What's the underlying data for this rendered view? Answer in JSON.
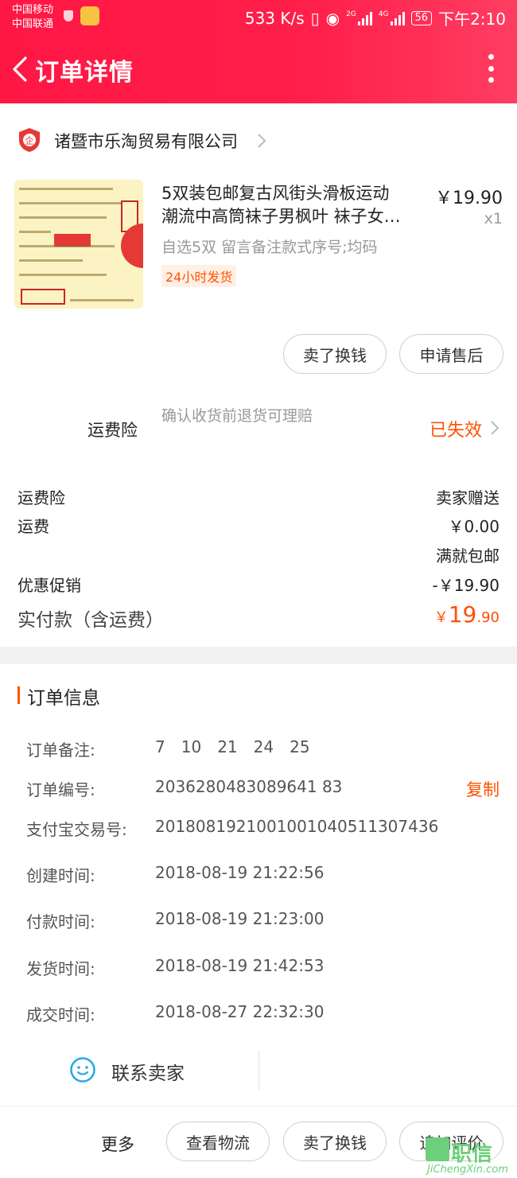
{
  "status_bar": {
    "carrier_1": "中国移动",
    "carrier_2": "中国联通",
    "speed": "533 K/s",
    "net_1": "2G",
    "net_2": "4G",
    "battery": "56",
    "time": "下午2:10"
  },
  "nav": {
    "title": "订单详情",
    "back_icon": "chevron-left-icon",
    "more_icon": "more-vertical-icon"
  },
  "shop": {
    "name": "诸暨市乐淘贸易有限公司",
    "icon": "enterprise-shield-icon",
    "icon_text": "企"
  },
  "product": {
    "title_line_1": "5双装包邮复古风街头滑板运动",
    "title_line_2": "潮流中高筒袜子男枫叶 袜子女…",
    "price": "￥19.90",
    "quantity": "x1",
    "sku": "自选5双 留言备注款式序号;均码",
    "badge": "24小时发货"
  },
  "item_actions": {
    "sell_exchange": "卖了换钱",
    "after_sale": "申请售后"
  },
  "insurance": {
    "label": "运费险",
    "description": "确认收货前退货可理赔",
    "status": "已失效"
  },
  "fees": [
    {
      "label": "运费险",
      "value": "卖家赠送"
    },
    {
      "label": "运费",
      "value": "￥0.00"
    },
    {
      "label": "",
      "value": "满就包邮"
    },
    {
      "label": "优惠促销",
      "value": "-￥19.90"
    }
  ],
  "total": {
    "label": "实付款（含运费）",
    "currency": "￥",
    "integer": "19",
    "decimal": ".90"
  },
  "order_info": {
    "title": "订单信息",
    "note_label": "订单备注:",
    "note_values": [
      "7",
      "10",
      "21",
      "24",
      "25"
    ],
    "order_no_label": "订单编号:",
    "order_no": "2036280483089641 83",
    "copy_label": "复制",
    "alipay_label": "支付宝交易号:",
    "alipay_no": "2018081921001001040511307436",
    "created_label": "创建时间:",
    "created": "2018-08-19 21:22:56",
    "paid_label": "付款时间:",
    "paid": "2018-08-19 21:23:00",
    "shipped_label": "发货时间:",
    "shipped": "2018-08-19 21:42:53",
    "completed_label": "成交时间:",
    "completed": "2018-08-27 22:32:30"
  },
  "contact": {
    "label": "联系卖家",
    "icon": "chat-smile-icon"
  },
  "bottom_bar": {
    "more": "更多",
    "logistics": "查看物流",
    "sell_exchange": "卖了换钱",
    "add_review": "追加评价"
  },
  "watermark": {
    "text": "职信",
    "url": "JiChengXin.com"
  },
  "colors": {
    "header": "#ff1744",
    "accent": "#ff5000",
    "muted": "#999999"
  }
}
